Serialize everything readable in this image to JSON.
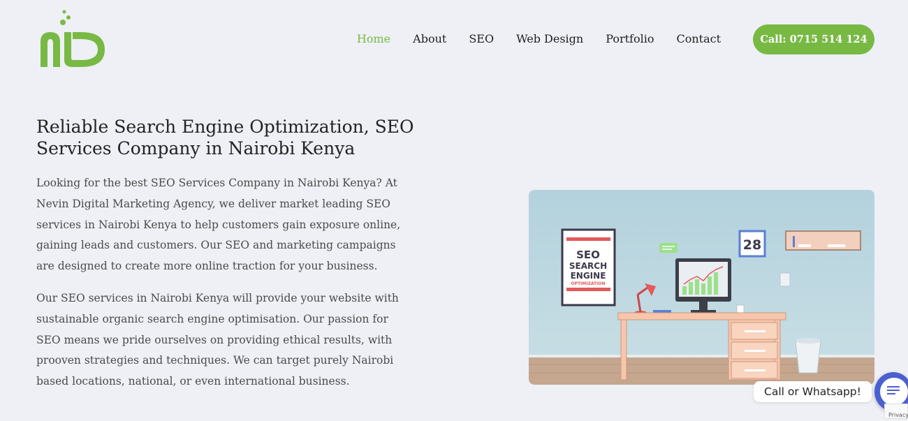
{
  "colors": {
    "brand_green": "#78b944",
    "chat_blue": "#4a5fd0",
    "background": "#eef0f5"
  },
  "nav": {
    "items": [
      {
        "label": "Home",
        "active": true
      },
      {
        "label": "About",
        "active": false
      },
      {
        "label": "SEO",
        "active": false
      },
      {
        "label": "Web Design",
        "active": false
      },
      {
        "label": "Portfolio",
        "active": false
      },
      {
        "label": "Contact",
        "active": false
      }
    ],
    "call_label": "Call: 0715 514 124"
  },
  "hero": {
    "title": "Reliable Search Engine Optimization, SEO Services Company in Nairobi Kenya",
    "paragraph1": "Looking for the best SEO Services Company in Nairobi Kenya? At Nevin Digital Marketing Agency, we deliver market leading SEO services in Nairobi Kenya to help customers gain exposure online, gaining leads and customers. Our SEO and marketing campaigns are designed to create more online traction for your business.",
    "paragraph2": "Our SEO services in Nairobi Kenya will provide your website with sustainable organic search engine optimisation. Our passion for SEO means we pride ourselves on providing ethical results, with prooven strategies and techniques. We can target purely Nairobi based locations, national, or even international business."
  },
  "illustration": {
    "poster_line1": "SEO",
    "poster_line2": "SEARCH",
    "poster_line3": "ENGINE",
    "poster_line4": "OPTIMIZATION",
    "calendar_day": "28"
  },
  "chat": {
    "bubble_text": "Call or Whatsapp!",
    "icon": "chat-icon"
  },
  "recaptcha": {
    "text": "Privacy"
  }
}
